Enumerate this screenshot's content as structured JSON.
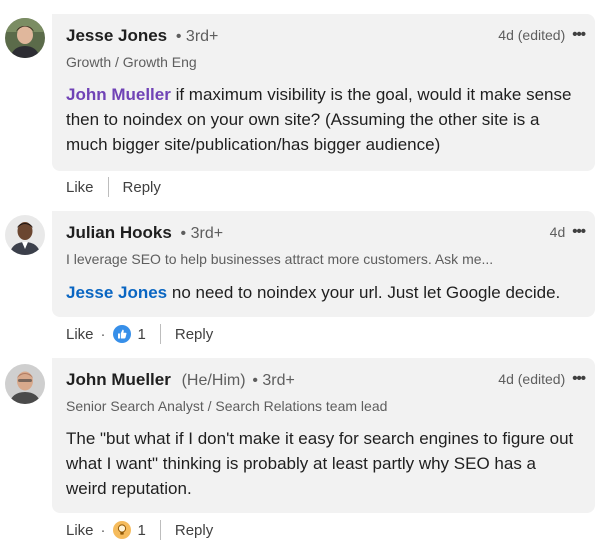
{
  "comments": [
    {
      "author": "Jesse Jones",
      "pronouns": "",
      "degree": "• 3rd+",
      "headline": "Growth / Growth Eng",
      "time": "4d (edited)",
      "mention": "John Mueller",
      "text": " if maximum visibility is the goal, would it make sense then to noindex on your own site? (Assuming the other site is a much bigger site/publication/has bigger audience)",
      "like_label": "Like",
      "reply_label": "Reply",
      "reaction_count": ""
    },
    {
      "author": "Julian Hooks",
      "pronouns": "",
      "degree": "• 3rd+",
      "headline": "I leverage SEO to help businesses attract more customers. Ask me...",
      "time": "4d",
      "mention": "Jesse Jones",
      "text": " no need to noindex your url. Just let Google decide.",
      "like_label": "Like",
      "reply_label": "Reply",
      "reaction_count": "1",
      "reaction_icon": "like-thumb-icon"
    },
    {
      "author": "John Mueller",
      "pronouns": "(He/Him)",
      "degree": "• 3rd+",
      "headline": "Senior Search Analyst / Search Relations team lead",
      "time": "4d (edited)",
      "mention": "",
      "text": "The \"but what if I don't make it easy for search engines to figure out what I want\" thinking is probably at least partly why SEO has a weird reputation.",
      "like_label": "Like",
      "reply_label": "Reply",
      "reaction_count": "1",
      "reaction_icon": "insightful-bulb-icon"
    }
  ],
  "more_label": "•••",
  "colors": {
    "bubble": "#f2f2f2",
    "mention_purple": "#7043b6",
    "mention_blue": "#0a66c2"
  }
}
